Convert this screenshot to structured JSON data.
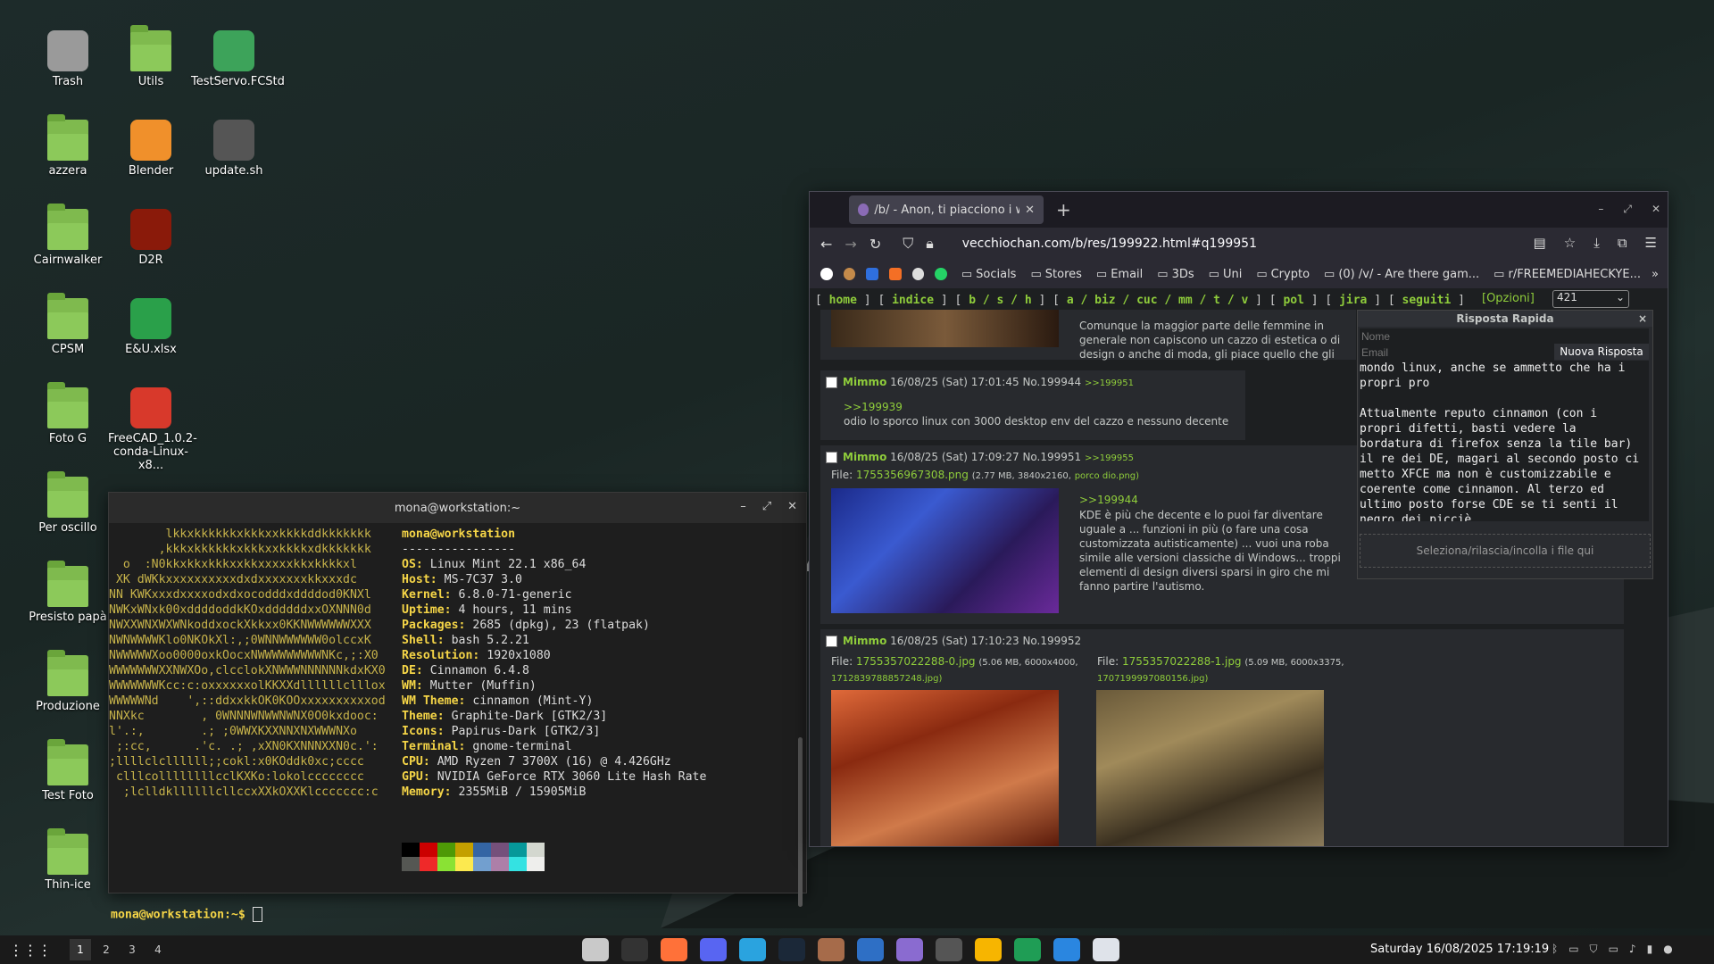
{
  "desktop": {
    "icons": [
      {
        "label": "Trash",
        "type": "trash"
      },
      {
        "label": "Utils",
        "type": "folder"
      },
      {
        "label": "TestServo.FCStd",
        "type": "archive"
      },
      {
        "label": "azzera",
        "type": "folder"
      },
      {
        "label": "Blender",
        "type": "blender"
      },
      {
        "label": "update.sh",
        "type": "script"
      },
      {
        "label": "Cairnwalker",
        "type": "folder"
      },
      {
        "label": "D2R",
        "type": "game"
      },
      {
        "label": "CPSM",
        "type": "folder"
      },
      {
        "label": "E&U.xlsx",
        "type": "spreadsheet"
      },
      {
        "label": "Foto G",
        "type": "folder"
      },
      {
        "label": "FreeCAD_1.0.2-conda-Linux-x8...",
        "type": "freecad"
      },
      {
        "label": "Per oscillo",
        "type": "folder"
      },
      {
        "label": "Presisto papà",
        "type": "folder"
      },
      {
        "label": "Produzione",
        "type": "folder"
      },
      {
        "label": "Test Foto",
        "type": "folder"
      },
      {
        "label": "Thin-ice",
        "type": "folder"
      }
    ]
  },
  "terminal": {
    "title": "mona@workstation:~",
    "user_host": "mona@workstation",
    "separator": "----------------",
    "info": [
      {
        "k": "OS",
        "v": "Linux Mint 22.1 x86_64"
      },
      {
        "k": "Host",
        "v": "MS-7C37 3.0"
      },
      {
        "k": "Kernel",
        "v": "6.8.0-71-generic"
      },
      {
        "k": "Uptime",
        "v": "4 hours, 11 mins"
      },
      {
        "k": "Packages",
        "v": "2685 (dpkg), 23 (flatpak)"
      },
      {
        "k": "Shell",
        "v": "bash 5.2.21"
      },
      {
        "k": "Resolution",
        "v": "1920x1080"
      },
      {
        "k": "DE",
        "v": "Cinnamon 6.4.8"
      },
      {
        "k": "WM",
        "v": "Mutter (Muffin)"
      },
      {
        "k": "WM Theme",
        "v": "cinnamon (Mint-Y)"
      },
      {
        "k": "Theme",
        "v": "Graphite-Dark [GTK2/3]"
      },
      {
        "k": "Icons",
        "v": "Papirus-Dark [GTK2/3]"
      },
      {
        "k": "Terminal",
        "v": "gnome-terminal"
      },
      {
        "k": "CPU",
        "v": "AMD Ryzen 7 3700X (16) @ 4.426GHz"
      },
      {
        "k": "GPU",
        "v": "NVIDIA GeForce RTX 3060 Lite Hash Rate"
      },
      {
        "k": "Memory",
        "v": "2355MiB / 15905MiB"
      }
    ],
    "art": [
      "        lkkxkkkkkkxkkkxxkkkkddkkkkkkk",
      "       ,kkkxkkkkkkxkkkxxkkkkxdkkkkkkk",
      "  o  :N0kkxkkxkkkxxkkxxxxxkkxkkkkxl",
      " XK dWKkxxxxxxxxxxdxdxxxxxxxkkxxxdc",
      "NN KWKxxxdxxxxodxdxocodddxddddod0KNXl",
      "NWKxWNxk00xddddoddkKOxddddddxxOXNNN0d",
      "NWXXWNXWXWNkoddxockXkkxx0KKNWWWWWWXXX",
      "NWNWWWWKlo0NKOkXl:,;0WNNWWWWWW0olccxK",
      "NWWWWWXoo0000oxkOocxNWWWWWWWWWNKc,;:X0",
      "WWWWWWWXXNWXOo,clcclokXNWWWNNNNNNkdxKX0",
      "WWWWWWWKcc:c:oxxxxxxolKKXXdllllllclllox",
      "WWWWWNd    ',::ddxxkkOK0KOOxxxxxxxxxxod",
      "NNXkc        , 0WNNNWNWWNWNX0O0kxdooc:",
      "l'.:,        .; ;0WWXKXXNNXNXWWWNXo",
      " ;:cc,      .'c. .; ,xXN0KXNNNXXN0c.':",
      ";llllclcllllll;;cokl:x0KOddk0xc;cccc",
      " clllcollllllllcclKXKo:lokolcccccccc",
      "  ;lclldkllllllcllccxXXkOXXKlccccccc:c"
    ],
    "palette_top": [
      "#000000",
      "#cc0000",
      "#4e9a06",
      "#c4a000",
      "#3465a4",
      "#75507b",
      "#06989a",
      "#d3d7cf"
    ],
    "palette_bottom": [
      "#555753",
      "#ef2929",
      "#8ae234",
      "#fce94f",
      "#729fcf",
      "#ad7fa8",
      "#34e2e2",
      "#eeeeec"
    ],
    "prompt": "mona@workstation:~$"
  },
  "browser": {
    "tab_title": "/b/ - Anon, ti piacciono i wall",
    "url": "vecchiochan.com/b/res/199922.html#q199951",
    "bookmarks": [
      "Socials",
      "Stores",
      "Email",
      "3Ds",
      "Uni",
      "Crypto",
      "(0) /v/ - Are there gam...",
      "r/FREEMEDIAHECKYE..."
    ],
    "nav": {
      "home": "home",
      "indice": "indice",
      "boards1": "b / s / h",
      "boards2": "a / biz / cuc / mm / t / v",
      "pol": "pol",
      "jira": "jira",
      "seguiti": "seguiti"
    },
    "opzioni": "[Opzioni]",
    "select_value": "421",
    "post0_text": "Comunque la maggior parte delle femmine in generale non capiscono un cazzo di estetica o di design o anche di moda, gli piace quello che gli dicono che deve piacergli.",
    "posts": [
      {
        "name": "Mimmo",
        "date": "16/08/25 (Sat) 17:01:45",
        "no": "No.199944",
        "reply": ">>199951",
        "quote": ">>199939",
        "text": "odio lo sporco linux con 3000 desktop env del cazzo e nessuno decente"
      },
      {
        "name": "Mimmo",
        "date": "16/08/25 (Sat) 17:09:27",
        "no": "No.199951",
        "reply": ">>199955",
        "file_label": "File:",
        "file": "1755356967308.png",
        "file_meta": "(2.77 MB, 3840x2160,",
        "file_orig": "porco dio.png)",
        "quote": ">>199944",
        "text": "KDE è più che decente e lo puoi far diventare uguale a ... funzioni in più (o fare una cosa customizzata autisticamente) ... vuoi una roba simile alle versioni classiche di Windows... troppi elementi di design diversi sparsi in giro che mi fanno partire l'autismo."
      },
      {
        "name": "Mimmo",
        "date": "16/08/25 (Sat) 17:10:23",
        "no": "No.199952",
        "file_label": "File:",
        "file1": "1755357022288-0.jpg",
        "file1_meta": "(5.06 MB, 6000x4000,",
        "file1_orig": "1712839788857248.jpg)",
        "file2": "1755357022288-1.jpg",
        "file2_meta": "(5.09 MB, 6000x3375,",
        "file2_orig": "1707199997080156.jpg)"
      }
    ],
    "quick_reply": {
      "title": "Risposta Rapida",
      "name_placeholder": "Nome",
      "email_placeholder": "Email",
      "submit": "Nuova Risposta",
      "text": "mondo linux, anche se ammetto che ha i\npropri pro\n\nAttualmente reputo cinnamon (con i\npropri difetti, basti vedere la\nbordatura di firefox senza la tile bar)\nil re dei DE, magari al secondo posto ci\nmetto XFCE ma non è customizzabile e\ncoerente come cinnamon. Al terzo ed\nultimo posto forse CDE se ti senti il\nnegro dei picciè",
      "files_label": "Seleziona/rilascia/incolla i file qui"
    }
  },
  "taskbar": {
    "workspaces": [
      "1",
      "2",
      "3",
      "4"
    ],
    "apps": [
      "files-app",
      "terminal-app",
      "firefox-app",
      "discord-app",
      "telegram-app",
      "steam-app",
      "gimp-app",
      "qbittorrent-app",
      "disk-app",
      "obs-app",
      "notepadpp-app",
      "spreadsheet-app",
      "thunderbird-app",
      "system-monitor-app"
    ],
    "clock": "Saturday 16/08/2025 17:19:19"
  },
  "colors": {
    "accent_green": "#8fcd3b",
    "term_key": "#f5d547"
  }
}
